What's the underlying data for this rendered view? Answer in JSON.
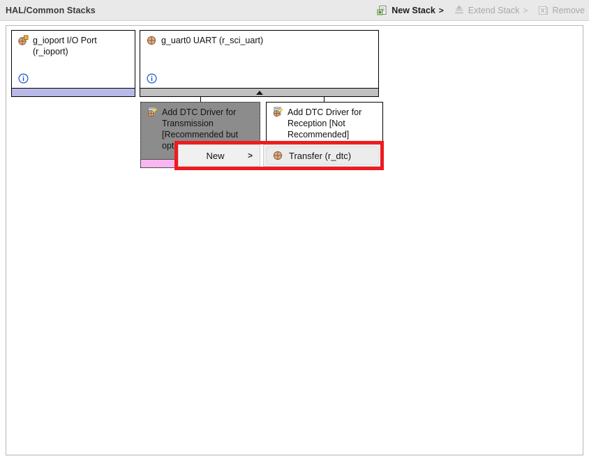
{
  "header": {
    "title": "HAL/Common Stacks",
    "toolbar": [
      {
        "label": "New Stack",
        "arrow": ">",
        "icon": "new-stack-icon",
        "enabled": true
      },
      {
        "label": "Extend Stack",
        "arrow": ">",
        "icon": "extend-stack-icon",
        "enabled": false
      },
      {
        "label": "Remove",
        "arrow": "",
        "icon": "remove-icon",
        "enabled": false
      }
    ]
  },
  "modules": {
    "ioport": {
      "title": "g_ioport I/O Port (r_ioport)",
      "icon": "module-icon",
      "info_icon": "info-icon",
      "footer_color": "#b9b9e8"
    },
    "uart": {
      "title": "g_uart0 UART (r_sci_uart)",
      "icon": "module-icon",
      "info_icon": "info-icon",
      "footer_color": "#c0c0c0",
      "footer_marker": "up-triangle-icon"
    },
    "dtc_tx": {
      "title": "Add DTC Driver for Transmission [Recommended but optional]",
      "icon": "add-module-icon",
      "footer_color": "#f8b7f0",
      "selected": true
    },
    "dtc_rx": {
      "title": "Add DTC Driver for Reception [Not Recommended]",
      "icon": "add-module-icon",
      "footer_color": "#f9bdf4",
      "selected": false
    }
  },
  "context_menu": {
    "new_item": {
      "label": "New",
      "submenu_arrow": ">"
    },
    "submenu": {
      "label": "Transfer (r_dtc)",
      "icon": "module-icon"
    }
  },
  "highlight": {
    "color": "#ee1b20"
  }
}
